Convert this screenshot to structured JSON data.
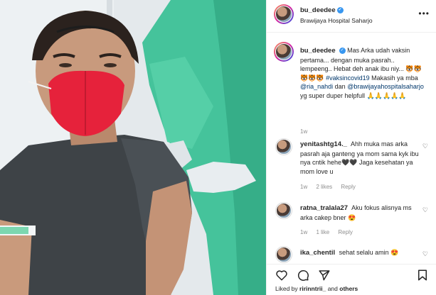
{
  "post": {
    "username": "bu_deedee",
    "location": "Brawijaya Hospital Saharjo"
  },
  "caption": {
    "username": "bu_deedee",
    "text_before": "Mas Arka udah vaksin pertama... dengan muka pasrah.. lempeeng.. Hebat deh anak ibu niy... 🐯🐯🐯🐯🐯 ",
    "hashtag": "#vaksincovid19",
    "text_middle": " Makasih ya mba ",
    "mention1": "@ria_nahdi",
    "text_and": " dan ",
    "mention2": "@brawijayahospitalsaharjo",
    "text_after": " yg super duper helpfull 🙏🙏🙏🙏🙏",
    "time": "1w"
  },
  "comments": [
    {
      "username": "yenitashtg14._",
      "text": "Ahh muka mas arka pasrah aja ganteng ya mom sama kyk ibu nya cntik hehe🖤🖤 Jaga kesehatan ya mom love u",
      "time": "1w",
      "likes": "2 likes",
      "reply": "Reply"
    },
    {
      "username": "ratna_tralala27",
      "text": "Aku fokus alisnya ms arka cakep bner 😍",
      "time": "1w",
      "likes": "1 like",
      "reply": "Reply"
    },
    {
      "username": "ika_chentil",
      "text": "sehat selalu amin 😍",
      "time": "",
      "likes": "",
      "reply": ""
    }
  ],
  "icons": {
    "more": "more-options-icon",
    "like": "heart-icon",
    "comment": "comment-icon",
    "share": "share-icon",
    "save": "bookmark-icon",
    "verified": "verified-badge-icon"
  },
  "likes": {
    "prefix": "Liked by ",
    "user": "ririnntrii_",
    "suffix": " and ",
    "others": "others"
  },
  "colors": {
    "link": "#00376b",
    "verified": "#3897f0",
    "muted": "#8e8e8e",
    "mask": "#e6223b",
    "ppe": "#3fbf95"
  }
}
